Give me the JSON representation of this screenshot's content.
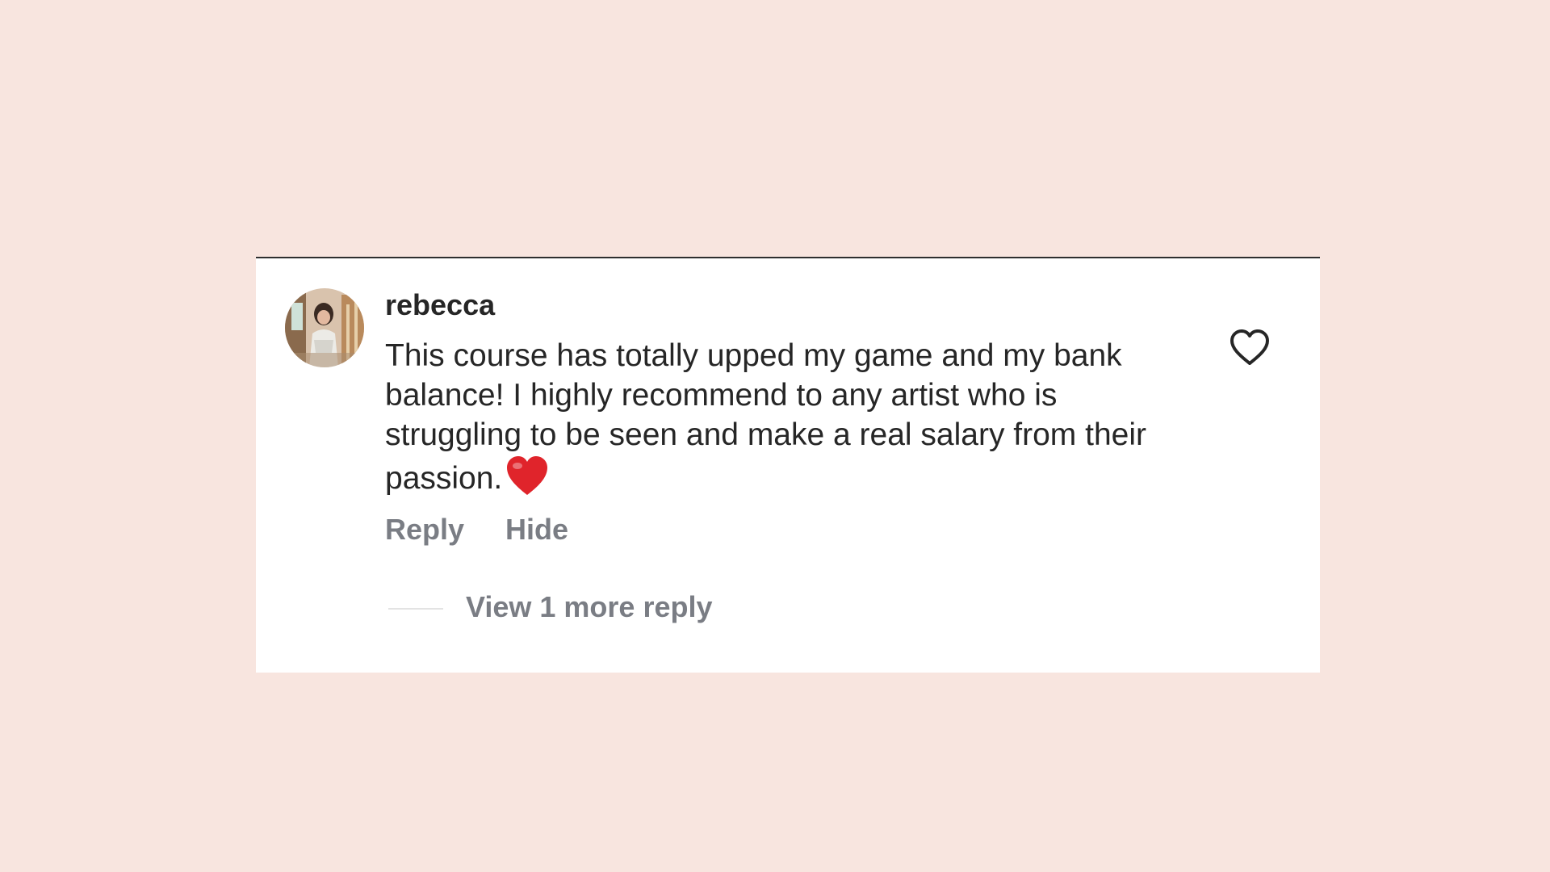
{
  "colors": {
    "background": "#f8e5df",
    "card": "#ffffff",
    "text": "#262626",
    "muted": "#7a7d84",
    "heart_emoji": "#e0242b"
  },
  "comment": {
    "username": "rebecca",
    "text": "This course has totally upped my game and my bank balance! I highly recommend to any artist who is struggling to be seen and make a real salary from their passion.",
    "emoji": "red-heart",
    "like_icon": "heart-outline-icon"
  },
  "actions": {
    "reply_label": "Reply",
    "hide_label": "Hide"
  },
  "replies": {
    "view_label": "View 1 more reply"
  }
}
